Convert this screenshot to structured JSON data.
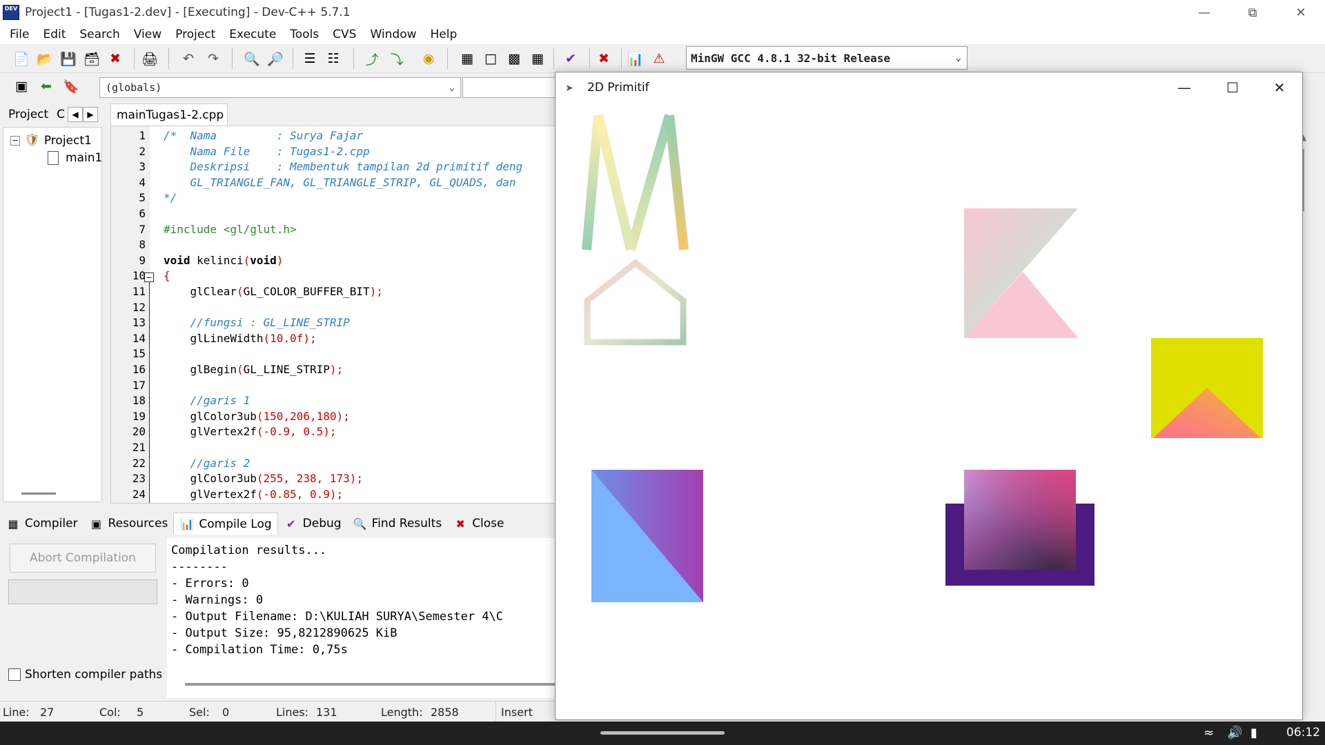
{
  "window": {
    "title": "Project1 - [Tugas1-2.dev] - [Executing] - Dev-C++ 5.7.1",
    "app_icon_text": "DEV"
  },
  "menu": [
    "File",
    "Edit",
    "Search",
    "View",
    "Project",
    "Execute",
    "Tools",
    "CVS",
    "Window",
    "Help"
  ],
  "toolbar": {
    "compiler": "MinGW GCC 4.8.1 32-bit Release",
    "scope": "(globals)"
  },
  "project_panel": {
    "tab_project": "Project",
    "tab_classes": "C",
    "root": "Project1",
    "file": "main1"
  },
  "editor": {
    "tab": "mainTugas1-2.cpp",
    "lines": [
      {
        "n": "1",
        "html": "<span class='c-com'>/*  Nama         : Surya Fajar</span>"
      },
      {
        "n": "2",
        "html": "<span class='c-com'>    Nama File    : Tugas1-2.cpp</span>"
      },
      {
        "n": "3",
        "html": "<span class='c-com'>    Deskripsi    : Membentuk tampilan 2d primitif deng</span>"
      },
      {
        "n": "4",
        "html": "<span class='c-com'>    GL_TRIANGLE_FAN, GL_TRIANGLE_STRIP, GL_QUADS, dan </span>"
      },
      {
        "n": "5",
        "html": "<span class='c-com'>*/</span>"
      },
      {
        "n": "6",
        "html": ""
      },
      {
        "n": "7",
        "html": "<span class='c-pre'>#include &lt;gl/glut.h&gt;</span>"
      },
      {
        "n": "8",
        "html": ""
      },
      {
        "n": "9",
        "html": "<span class='c-kw'>void</span> kelinci<span class='c-sym'>(</span><span class='c-kw'>void</span><span class='c-sym'>)</span>"
      },
      {
        "n": "10",
        "html": "<span class='c-sym'>{</span>"
      },
      {
        "n": "11",
        "html": "    glClear<span class='c-sym'>(</span>GL_COLOR_BUFFER_BIT<span class='c-sym'>);</span>"
      },
      {
        "n": "12",
        "html": ""
      },
      {
        "n": "13",
        "html": "    <span class='c-com'>//fungsi : GL_LINE_STRIP</span>"
      },
      {
        "n": "14",
        "html": "    glLineWidth<span class='c-sym'>(</span><span class='c-num'>10.0f</span><span class='c-sym'>);</span>"
      },
      {
        "n": "15",
        "html": ""
      },
      {
        "n": "16",
        "html": "    glBegin<span class='c-sym'>(</span>GL_LINE_STRIP<span class='c-sym'>);</span>"
      },
      {
        "n": "17",
        "html": ""
      },
      {
        "n": "18",
        "html": "    <span class='c-com'>//garis 1</span>"
      },
      {
        "n": "19",
        "html": "    glColor3ub<span class='c-sym'>(</span><span class='c-num'>150</span><span class='c-sym'>,</span><span class='c-num'>206</span><span class='c-sym'>,</span><span class='c-num'>180</span><span class='c-sym'>);</span>"
      },
      {
        "n": "20",
        "html": "    glVertex2f<span class='c-sym'>(</span><span class='c-num'>-0.9</span><span class='c-sym'>,</span> <span class='c-num'>0.5</span><span class='c-sym'>);</span>"
      },
      {
        "n": "21",
        "html": ""
      },
      {
        "n": "22",
        "html": "    <span class='c-com'>//garis 2</span>"
      },
      {
        "n": "23",
        "html": "    glColor3ub<span class='c-sym'>(</span><span class='c-num'>255</span><span class='c-sym'>,</span> <span class='c-num'>238</span><span class='c-sym'>,</span> <span class='c-num'>173</span><span class='c-sym'>);</span>"
      },
      {
        "n": "24",
        "html": "    glVertex2f<span class='c-sym'>(</span><span class='c-num'>-0.85</span><span class='c-sym'>,</span> <span class='c-num'>0.9</span><span class='c-sym'>);</span>"
      }
    ]
  },
  "bottom_tabs": [
    "Compiler",
    "Resources",
    "Compile Log",
    "Debug",
    "Find Results",
    "Close"
  ],
  "compile": {
    "abort_label": "Abort Compilation",
    "shorten_label": "Shorten compiler paths",
    "log": [
      "Compilation results...",
      "--------",
      "- Errors: 0",
      "- Warnings: 0",
      "- Output Filename: D:\\KULIAH SURYA\\Semester 4\\C",
      "- Output Size: 95,8212890625 KiB",
      "- Compilation Time: 0,75s"
    ]
  },
  "status": {
    "line_label": "Line:",
    "line": "27",
    "col_label": "Col:",
    "col": "5",
    "sel_label": "Sel:",
    "sel": "0",
    "lines_label": "Lines:",
    "lines": "131",
    "length_label": "Length:",
    "length": "2858",
    "mode": "Insert"
  },
  "glut": {
    "title": "2D Primitif"
  },
  "taskbar": {
    "clock": "06:12"
  },
  "colors": {
    "accent_comment": "#2a7fd4",
    "keyword_num": "#d40000",
    "preprocessor": "#2e8b2e",
    "yellow_square": "#e0e000",
    "purple_frame": "#4d1a7f",
    "blue_square": "#7ab3ff"
  }
}
